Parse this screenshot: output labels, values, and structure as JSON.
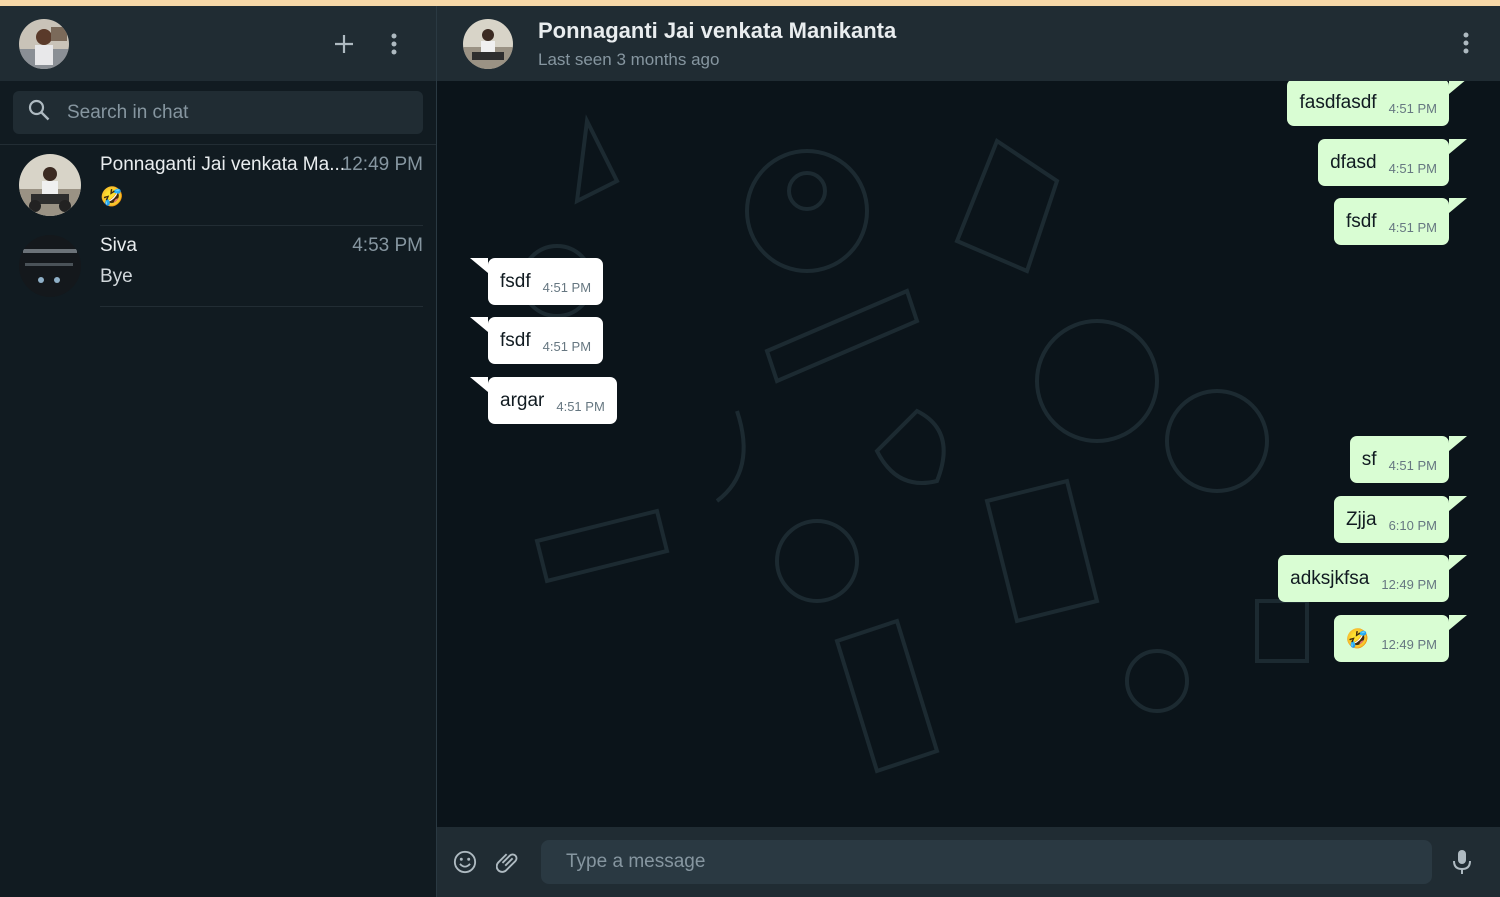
{
  "colors": {
    "accent_outgoing": "#d9fdd3",
    "incoming": "#ffffff",
    "header": "#202c33",
    "background": "#0b141a"
  },
  "sidebar": {
    "icons": [
      "profile-avatar",
      "plus-icon",
      "kebab-menu-icon"
    ],
    "search": {
      "placeholder": "Search in chat",
      "icon": "search-icon"
    },
    "chats": [
      {
        "name": "Ponnaganti Jai venkata Ma...",
        "time": "12:49 PM",
        "preview": "🤣"
      },
      {
        "name": "Siva",
        "time": "4:53 PM",
        "preview": "Bye"
      }
    ]
  },
  "conversation": {
    "contact_name": "Ponnaganti Jai venkata Manikanta",
    "status": "Last seen 3 months ago",
    "messages": [
      {
        "dir": "out",
        "text": "fasdfasdf",
        "time": "4:51 PM"
      },
      {
        "dir": "out",
        "text": "dfasd",
        "time": "4:51 PM"
      },
      {
        "dir": "out",
        "text": "fsdf",
        "time": "4:51 PM"
      },
      {
        "dir": "in",
        "text": "fsdf",
        "time": "4:51 PM"
      },
      {
        "dir": "in",
        "text": "fsdf",
        "time": "4:51 PM"
      },
      {
        "dir": "in",
        "text": "argar",
        "time": "4:51 PM"
      },
      {
        "dir": "out",
        "text": "sf",
        "time": "4:51 PM"
      },
      {
        "dir": "out",
        "text": "Zjja",
        "time": "6:10 PM"
      },
      {
        "dir": "out",
        "text": "adksjkfsa",
        "time": "12:49 PM"
      },
      {
        "dir": "out",
        "text": "🤣",
        "time": "12:49 PM"
      }
    ]
  },
  "composer": {
    "placeholder": "Type a message",
    "icons": [
      "emoji-icon",
      "attach-icon",
      "microphone-icon"
    ]
  }
}
